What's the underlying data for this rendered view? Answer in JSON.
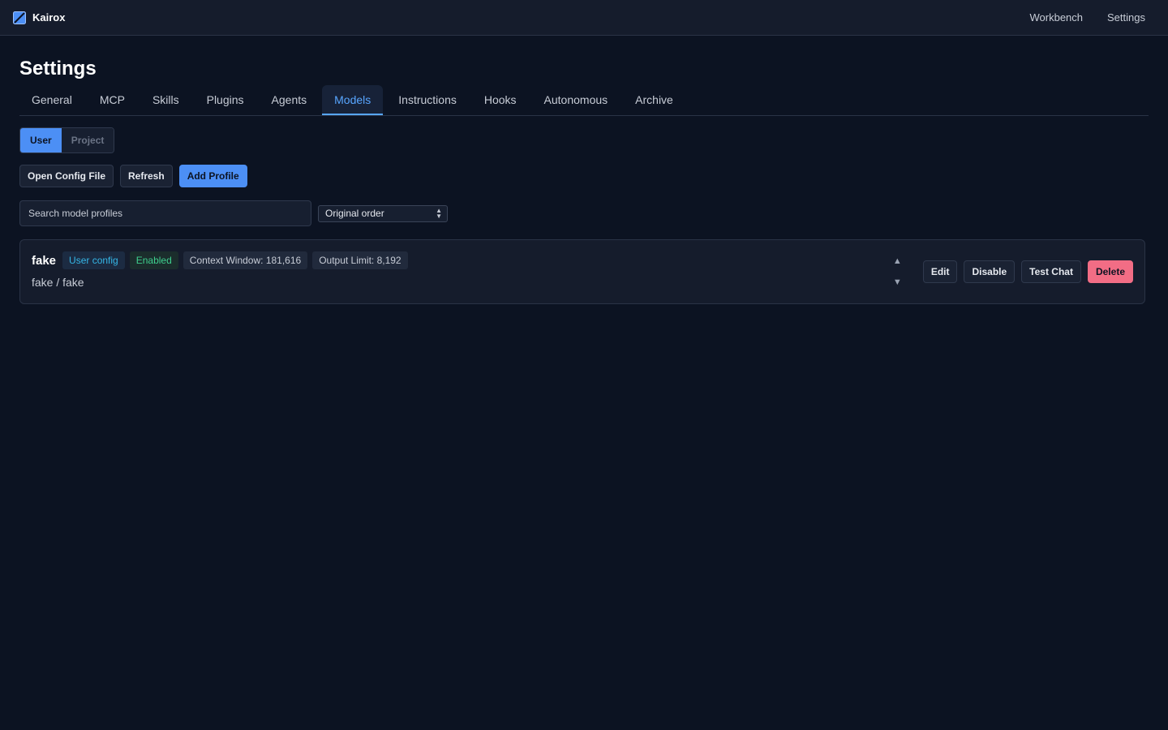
{
  "app": {
    "name": "Kairox",
    "logo_icon": "kairox-logo-icon"
  },
  "topnav": {
    "workbench": "Workbench",
    "settings": "Settings"
  },
  "page": {
    "title": "Settings"
  },
  "tabs": [
    {
      "label": "General"
    },
    {
      "label": "MCP"
    },
    {
      "label": "Skills"
    },
    {
      "label": "Plugins"
    },
    {
      "label": "Agents"
    },
    {
      "label": "Models"
    },
    {
      "label": "Instructions"
    },
    {
      "label": "Hooks"
    },
    {
      "label": "Autonomous"
    },
    {
      "label": "Archive"
    }
  ],
  "active_tab": "Models",
  "scope": {
    "user": "User",
    "project": "Project",
    "selected": "User"
  },
  "actions": {
    "open_config": "Open Config File",
    "refresh": "Refresh",
    "add_profile": "Add Profile"
  },
  "search": {
    "placeholder": "Search model profiles",
    "value": ""
  },
  "sort": {
    "value": "Original order",
    "icon": "chevron-updown-icon"
  },
  "profiles": [
    {
      "name": "fake",
      "source_badge": "User config",
      "status_badge": "Enabled",
      "context_window": "Context Window: 181,616",
      "output_limit": "Output Limit: 8,192",
      "subtitle": "fake / fake",
      "move_up": "▲",
      "move_down": "▼",
      "edit": "Edit",
      "toggle": "Disable",
      "test": "Test Chat",
      "delete": "Delete"
    }
  ],
  "colors": {
    "accent": "#58a6ff",
    "primary_button": "#4c8ff5",
    "danger": "#f26d85",
    "enabled": "#3ecf8e",
    "user_config": "#35b6e6",
    "background": "#0c1322"
  }
}
